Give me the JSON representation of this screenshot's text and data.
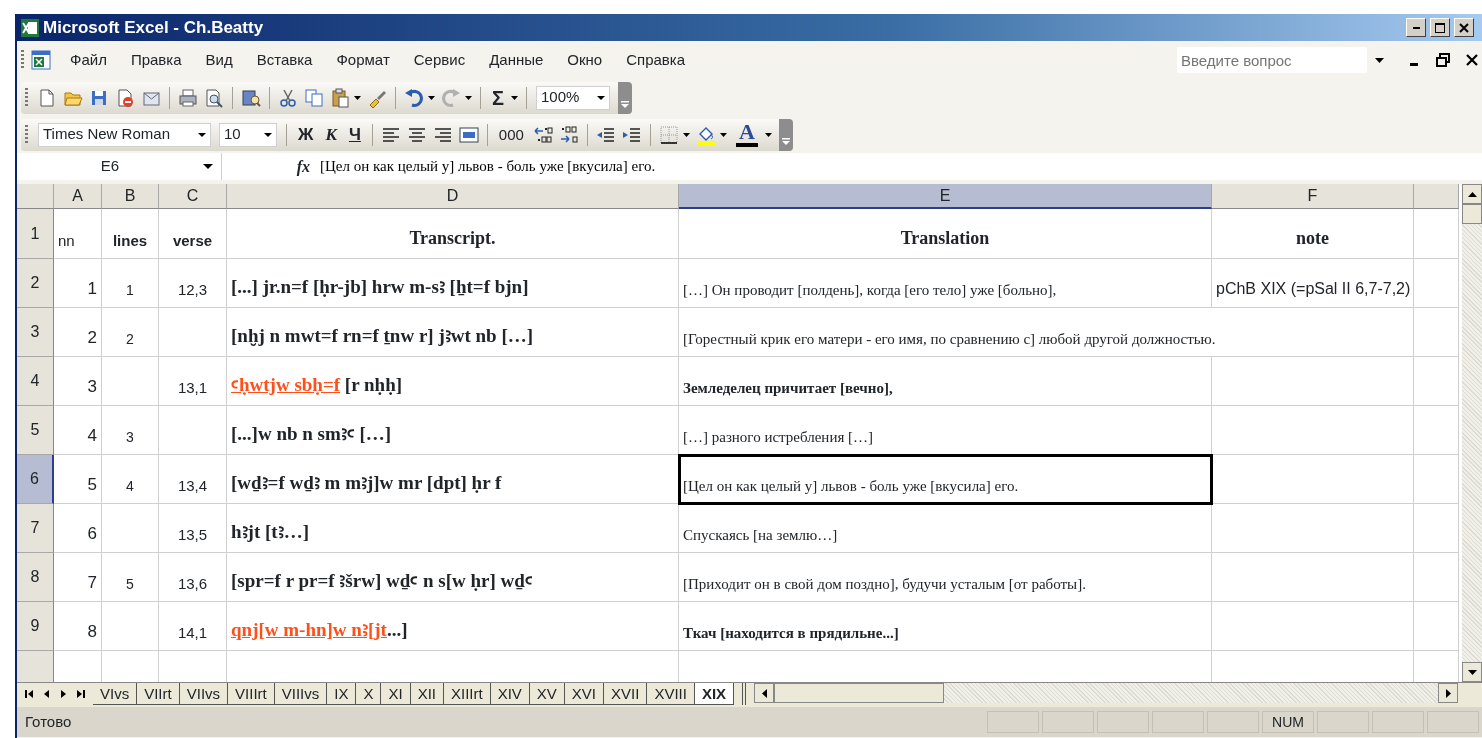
{
  "window": {
    "title": "Microsoft Excel - Ch.Beatty"
  },
  "menu": [
    "Файл",
    "Правка",
    "Вид",
    "Вставка",
    "Формат",
    "Сервис",
    "Данные",
    "Окно",
    "Справка"
  ],
  "help_box": {
    "placeholder": "Введите вопрос"
  },
  "standard_toolbar": [
    {
      "kind": "new"
    },
    {
      "kind": "open"
    },
    {
      "kind": "save"
    },
    {
      "kind": "permission"
    },
    {
      "kind": "mail"
    },
    {
      "kind": "sep"
    },
    {
      "kind": "print"
    },
    {
      "kind": "preview"
    },
    {
      "kind": "sep"
    },
    {
      "kind": "research"
    },
    {
      "kind": "sep"
    },
    {
      "kind": "cut"
    },
    {
      "kind": "copy"
    },
    {
      "kind": "paste"
    },
    {
      "kind": "arrow"
    },
    {
      "kind": "painter"
    },
    {
      "kind": "sep"
    },
    {
      "kind": "undo"
    },
    {
      "kind": "arrow"
    },
    {
      "kind": "redo"
    },
    {
      "kind": "arrow"
    },
    {
      "kind": "sep"
    },
    {
      "kind": "sum",
      "label": "Σ"
    },
    {
      "kind": "arrow"
    },
    {
      "kind": "sep"
    },
    {
      "kind": "combo",
      "value": "100%"
    }
  ],
  "formatting_toolbar": [
    {
      "kind": "combo",
      "value": "Times New Roman"
    },
    {
      "kind": "combo",
      "value": "10"
    },
    {
      "kind": "sep"
    },
    {
      "kind": "bold",
      "label": "Ж"
    },
    {
      "kind": "italic",
      "label": "К"
    },
    {
      "kind": "underline",
      "label": "Ч"
    },
    {
      "kind": "sep"
    },
    {
      "kind": "align-left"
    },
    {
      "kind": "align-center"
    },
    {
      "kind": "align-right"
    },
    {
      "kind": "merge"
    },
    {
      "kind": "sep"
    },
    {
      "kind": "text",
      "label": "000"
    },
    {
      "kind": "inc-decimal"
    },
    {
      "kind": "dec-decimal"
    },
    {
      "kind": "sep"
    },
    {
      "kind": "outdent"
    },
    {
      "kind": "indent"
    },
    {
      "kind": "sep"
    },
    {
      "kind": "borders"
    },
    {
      "kind": "arrow"
    },
    {
      "kind": "fill"
    },
    {
      "kind": "arrow"
    },
    {
      "kind": "font-color",
      "label": "A"
    },
    {
      "kind": "arrow"
    }
  ],
  "formula_bar": {
    "name_box": "E6",
    "fx": "fx",
    "value": "[Цел он как целый у] львов - боль уже [вкусила] его."
  },
  "columns": [
    {
      "label": "A",
      "selected": false
    },
    {
      "label": "B",
      "selected": false
    },
    {
      "label": "C",
      "selected": false
    },
    {
      "label": "D",
      "selected": false
    },
    {
      "label": "E",
      "selected": true
    },
    {
      "label": "F",
      "selected": false
    }
  ],
  "rows": [
    {
      "header": "1",
      "kind": "header",
      "selected": false,
      "cells": [
        {
          "text": "nn"
        },
        {
          "text": "lines"
        },
        {
          "text": "verse"
        },
        {
          "text": "Transcript."
        },
        {
          "text": "Translation"
        },
        {
          "text": "note"
        }
      ]
    },
    {
      "header": "2",
      "kind": "data",
      "selected": false,
      "cells": [
        {
          "text": "1"
        },
        {
          "text": "1"
        },
        {
          "text": "12,3"
        },
        {
          "parts": [
            {
              "text": "[...] jr.n=f [ḥr-jb] hrw m-sꜣ [ẖt=f bjn]",
              "marked": false
            }
          ]
        },
        {
          "text": "[…] Он проводит [полдень], когда [его тело] уже [больно],",
          "bold": false
        },
        {
          "text": "pChB XIX (=pSal II 6,7-7,2)"
        }
      ]
    },
    {
      "header": "3",
      "kind": "data",
      "selected": false,
      "cells": [
        {
          "text": "2"
        },
        {
          "text": "2"
        },
        null,
        {
          "parts": [
            {
              "text": "[nḫj n mwt=f rn=f ṯnw r] jꜣwt nb […]",
              "marked": false
            }
          ]
        },
        {
          "text": "[Горестный крик его матери - его имя, по сравнению с] любой другой должностью.",
          "bold": false
        },
        null
      ]
    },
    {
      "header": "4",
      "kind": "data",
      "selected": false,
      "cells": [
        {
          "text": "3"
        },
        null,
        {
          "text": "13,1"
        },
        {
          "parts": [
            {
              "text": "ꜥḥwtjw sbḥ=f",
              "marked": true
            },
            {
              "text": " [r nḥḥ]",
              "marked": false
            }
          ]
        },
        {
          "text": "Земледелец причитает [вечно],",
          "bold": true
        },
        null
      ]
    },
    {
      "header": "5",
      "kind": "data",
      "selected": false,
      "cells": [
        {
          "text": "4"
        },
        {
          "text": "3"
        },
        null,
        {
          "parts": [
            {
              "text": "[...]w nb n smꜣꜥ […]",
              "marked": false
            }
          ]
        },
        {
          "text": "[…] разного истребления […]",
          "bold": false
        },
        null
      ]
    },
    {
      "header": "6",
      "kind": "data",
      "selected": true,
      "cells": [
        {
          "text": "5"
        },
        {
          "text": "4"
        },
        {
          "text": "13,4"
        },
        {
          "parts": [
            {
              "text": "[wḏꜣ=f wḏꜣ m mꜣj]w mr [dpt] ḥr f",
              "marked": false
            }
          ]
        },
        {
          "text": "[Цел он как целый у] львов - боль уже [вкусила] его.",
          "bold": false
        },
        null
      ]
    },
    {
      "header": "7",
      "kind": "data",
      "selected": false,
      "cells": [
        {
          "text": "6"
        },
        null,
        {
          "text": "13,5"
        },
        {
          "parts": [
            {
              "text": "hꜣjt [tꜣ…]",
              "marked": false
            }
          ]
        },
        {
          "text": "Спускаясь [на землю…]",
          "bold": false
        },
        null
      ]
    },
    {
      "header": "8",
      "kind": "data",
      "selected": false,
      "cells": [
        {
          "text": "7"
        },
        {
          "text": "5"
        },
        {
          "text": "13,6"
        },
        {
          "parts": [
            {
              "text": "[spr=f r pr=f ꜣšrw] wḏꜥ n s[w ḥr] wḏꜥ",
              "marked": false
            }
          ]
        },
        {
          "text": "[Приходит он в свой дом поздно], будучи усталым [от работы].",
          "bold": false
        },
        null
      ]
    },
    {
      "header": "9",
      "kind": "data",
      "selected": false,
      "cells": [
        {
          "text": "8"
        },
        null,
        {
          "text": "14,1"
        },
        {
          "parts": [
            {
              "text": "qnj[w m-hn]w nꜣ[jt",
              "marked": true
            },
            {
              "text": "...]",
              "marked": false
            }
          ]
        },
        {
          "text": "Ткач [находится в прядильне...]",
          "bold": true
        },
        null
      ]
    }
  ],
  "sheet_tabs": [
    {
      "label": "VIvs",
      "selected": false
    },
    {
      "label": "VIIrt",
      "selected": false
    },
    {
      "label": "VIIvs",
      "selected": false
    },
    {
      "label": "VIIIrt",
      "selected": false
    },
    {
      "label": "VIIIvs",
      "selected": false
    },
    {
      "label": "IX",
      "selected": false
    },
    {
      "label": "X",
      "selected": false
    },
    {
      "label": "XI",
      "selected": false
    },
    {
      "label": "XII",
      "selected": false
    },
    {
      "label": "XIIIrt",
      "selected": false
    },
    {
      "label": "XIV",
      "selected": false
    },
    {
      "label": "XV",
      "selected": false
    },
    {
      "label": "XVI",
      "selected": false
    },
    {
      "label": "XVII",
      "selected": false
    },
    {
      "label": "XVIII",
      "selected": false
    },
    {
      "label": "XIX",
      "selected": true
    }
  ],
  "status_bar": {
    "text": "Готово",
    "indicators": [
      "NUM"
    ]
  }
}
